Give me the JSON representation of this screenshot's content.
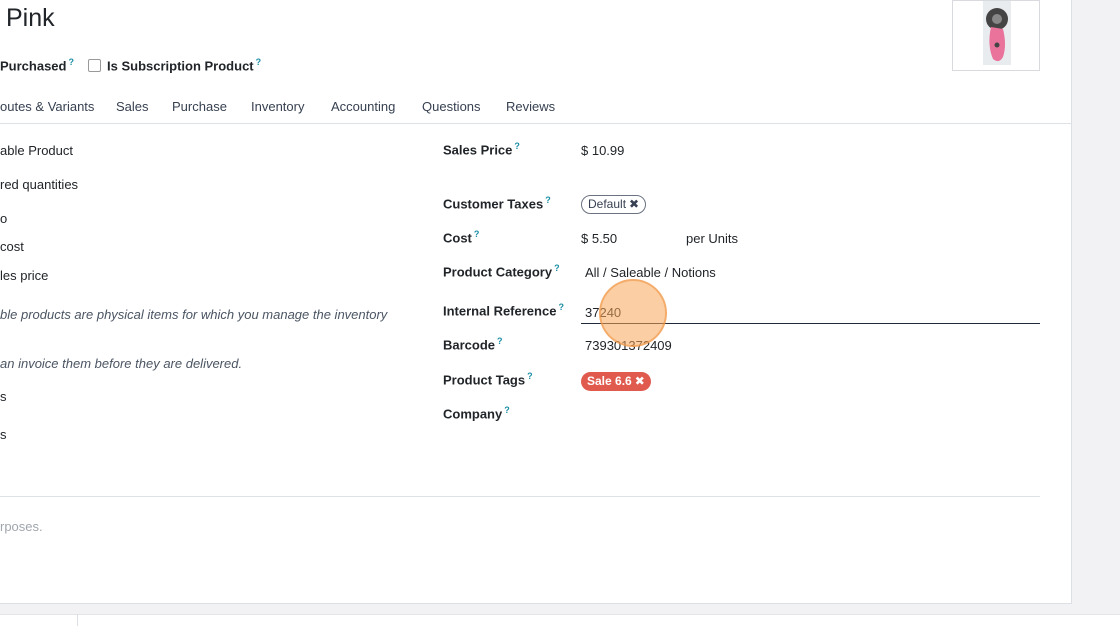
{
  "header": {
    "title": "Pink",
    "can_be_purchased": "Purchased",
    "is_subscription": "Is Subscription Product",
    "help_mark": "?"
  },
  "tabs": [
    {
      "label": "outes & Variants"
    },
    {
      "label": "Sales"
    },
    {
      "label": "Purchase"
    },
    {
      "label": "Inventory"
    },
    {
      "label": "Accounting"
    },
    {
      "label": "Questions"
    },
    {
      "label": "Reviews"
    }
  ],
  "left_column": {
    "product_type": "able Product",
    "invoicing_policy": "red quantities",
    "line3": "o",
    "line4": " cost",
    "line5": "les price",
    "note1": "ble products are physical items for which you manage the inventory",
    "note2": "an invoice them before they are delivered.",
    "line8": "s",
    "line9": "s"
  },
  "fields": {
    "sales_price_label": "Sales Price",
    "sales_price_value": "$ 10.99",
    "customer_taxes_label": "Customer Taxes",
    "customer_taxes_badge": "Default",
    "cost_label": "Cost",
    "cost_value": "$ 5.50",
    "cost_unit": "per Units",
    "category_label": "Product Category",
    "category_value": "All / Saleable / Notions",
    "internal_ref_label": "Internal Reference",
    "internal_ref_value": "37240",
    "barcode_label": "Barcode",
    "barcode_value": "739301372409",
    "tags_label": "Product Tags",
    "tag_value": "Sale 6.6",
    "company_label": "Company",
    "remove_glyph": "✖"
  },
  "footer": {
    "note": "rposes."
  }
}
